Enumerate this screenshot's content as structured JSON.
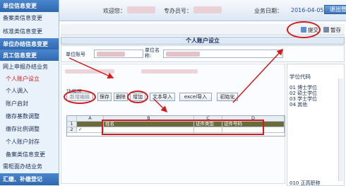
{
  "sidebar": {
    "items": [
      {
        "label": "单位信息变更",
        "kind": "header"
      },
      {
        "label": "备案类信息变更",
        "kind": "sub"
      },
      {
        "label": "核准类信息变更",
        "kind": "sub"
      },
      {
        "label": "单位办结信息变更",
        "kind": "header"
      },
      {
        "label": "员工信息变更",
        "kind": "header"
      },
      {
        "label": "网上申报办结业务",
        "kind": "sub"
      },
      {
        "label": "个人账户设立",
        "kind": "child",
        "active": true
      },
      {
        "label": "个人调入",
        "kind": "child"
      },
      {
        "label": "账户启封",
        "kind": "child"
      },
      {
        "label": "缴存基数调整",
        "kind": "child"
      },
      {
        "label": "缴存比例调整",
        "kind": "child"
      },
      {
        "label": "个人账户封存",
        "kind": "child"
      },
      {
        "label": "备案类信息变更",
        "kind": "child"
      },
      {
        "label": "需柜面办结业务",
        "kind": "sub"
      },
      {
        "label": "汇缴、补缴登记",
        "kind": "header"
      }
    ]
  },
  "topbar": {
    "welcome_label": "欢迎您：",
    "operator_label": "专办员号：",
    "date_label": "业务日期：",
    "date_value": "2016-04-05",
    "logout_label": "退出登录"
  },
  "toolbar": {
    "submit_label": "提交",
    "save_label": "暂存"
  },
  "form": {
    "title": "个人账户设立",
    "unit_account_label": "单位账号",
    "unit_name_label": "单位名\n称:",
    "feature_label": "功能区:",
    "buttons": {
      "new_edit": "新增编辑",
      "save": "保存",
      "delete": "删除",
      "add": "增加",
      "text_import": "文本导入",
      "excel_import": "excel导入",
      "init": "初始化"
    }
  },
  "grid": {
    "col_headers": [
      "A",
      "B",
      "C",
      "D"
    ],
    "row_numbers": [
      "1",
      "2"
    ],
    "row2_check": "✓",
    "data_headers": [
      "姓名",
      "证件类型",
      "证件号码"
    ]
  },
  "right_panel": {
    "title": "学位代码",
    "items": [
      "01 博士学位",
      "02 硕士学位",
      "03 学士学位",
      "04 其他",
      "010 正高职称"
    ]
  },
  "colors": {
    "annotation": "#d21c1c",
    "sidebar_header": "#3b73bb",
    "date_text": "#1f4ea6"
  }
}
